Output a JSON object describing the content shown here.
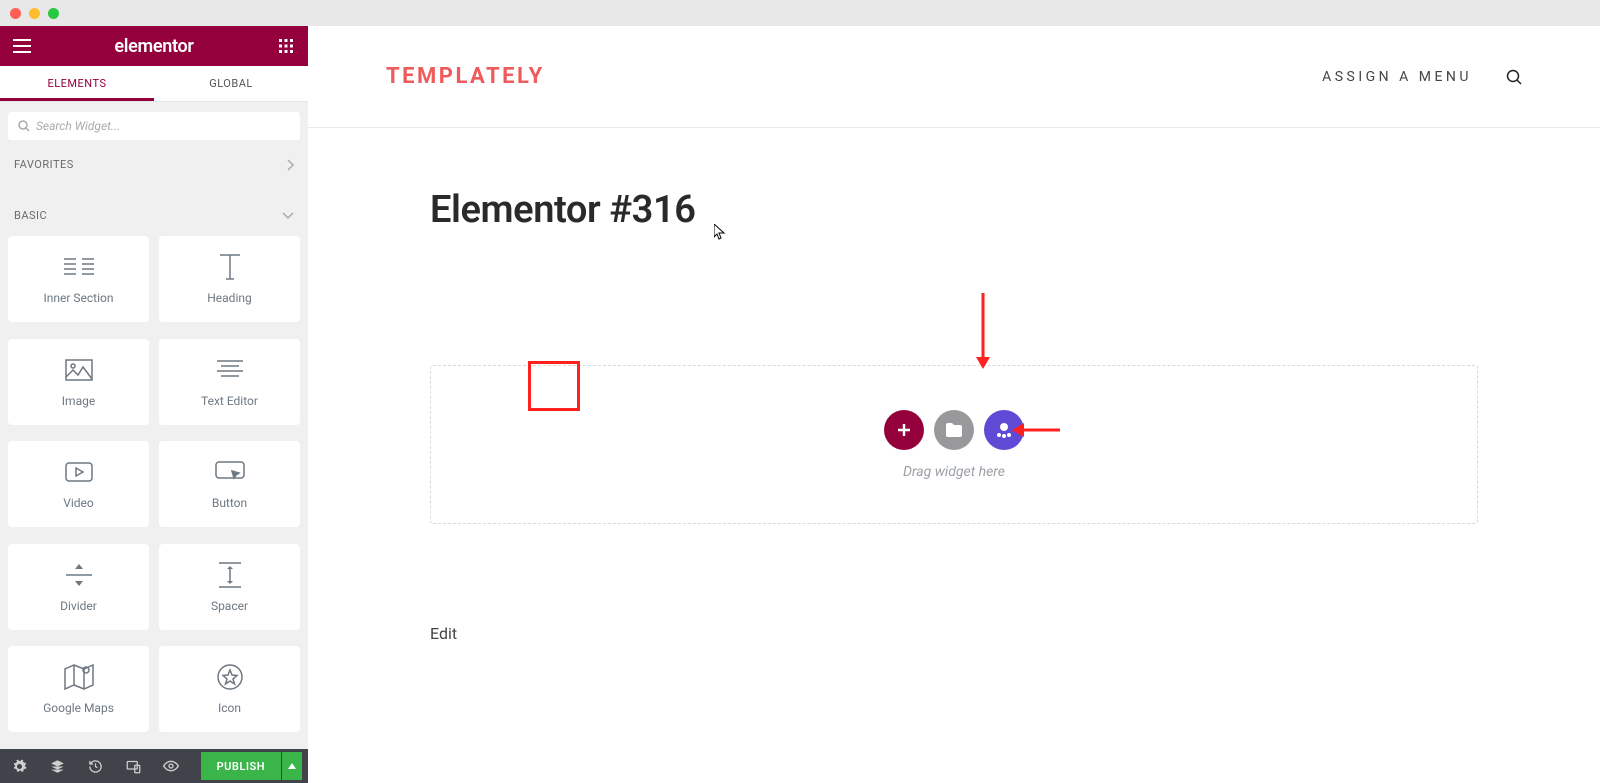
{
  "sidebar": {
    "logo": "elementor",
    "tabs": {
      "elements": "ELEMENTS",
      "global": "GLOBAL"
    },
    "search_placeholder": "Search Widget...",
    "sections": {
      "favorites": "FAVORITES",
      "basic": "BASIC"
    },
    "widgets": [
      {
        "key": "inner-section",
        "label": "Inner Section"
      },
      {
        "key": "heading",
        "label": "Heading"
      },
      {
        "key": "image",
        "label": "Image"
      },
      {
        "key": "text-editor",
        "label": "Text Editor"
      },
      {
        "key": "video",
        "label": "Video"
      },
      {
        "key": "button",
        "label": "Button"
      },
      {
        "key": "divider",
        "label": "Divider"
      },
      {
        "key": "spacer",
        "label": "Spacer"
      },
      {
        "key": "google-maps",
        "label": "Google Maps"
      },
      {
        "key": "icon",
        "label": "Icon"
      }
    ],
    "footer": {
      "publish": "PUBLISH"
    }
  },
  "site": {
    "brand": "TEMPLATELY",
    "menu": "ASSIGN A MENU"
  },
  "page": {
    "title": "Elementor #316",
    "drag_hint": "Drag widget here",
    "edit": "Edit"
  }
}
